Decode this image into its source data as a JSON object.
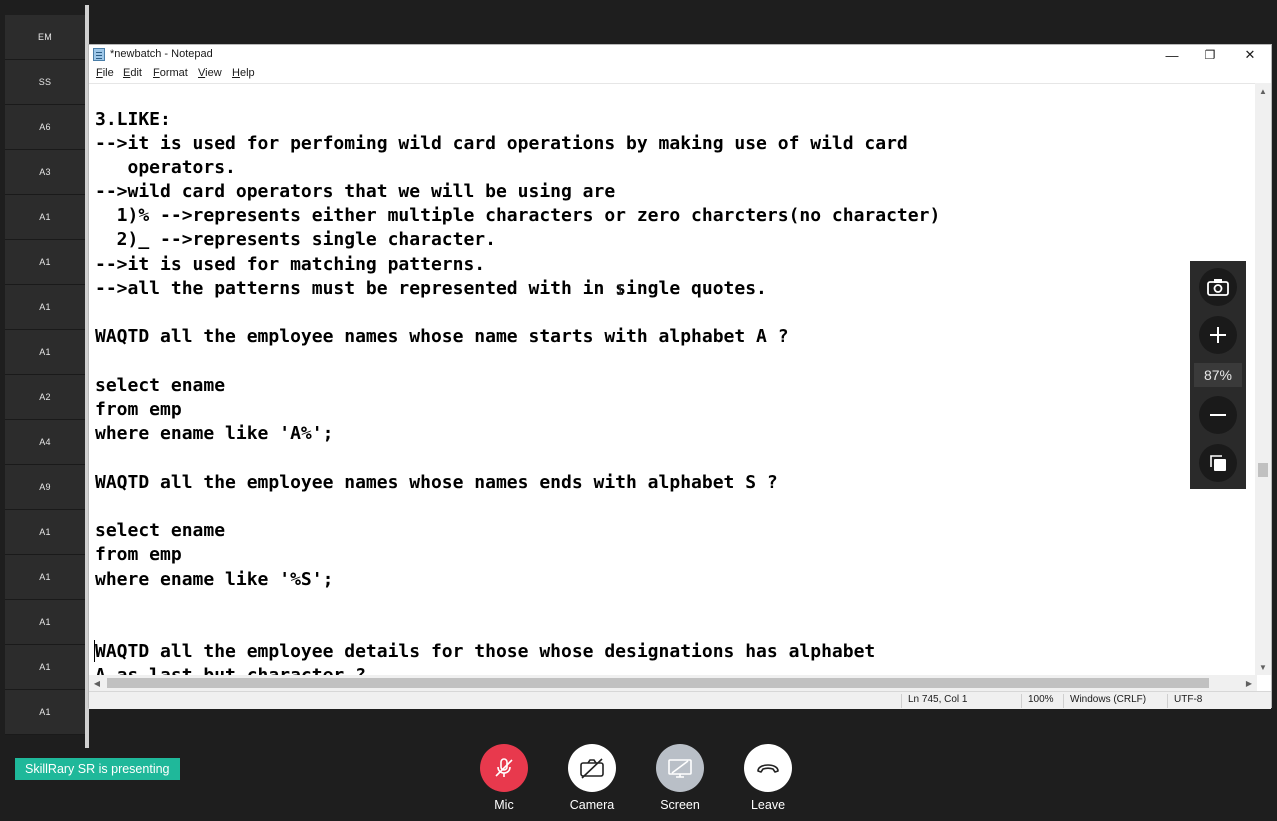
{
  "participants": [
    "EM",
    "SS",
    "A6",
    "A3",
    "A1",
    "A1",
    "A1",
    "A1",
    "A2",
    "A4",
    "A9",
    "A1",
    "A1",
    "A1",
    "A1",
    "A1"
  ],
  "notepad": {
    "title": "*newbatch - Notepad",
    "window_buttons": {
      "minimize": "—",
      "restore": "❐",
      "close": "✕"
    },
    "menu": [
      "File",
      "Edit",
      "Format",
      "View",
      "Help"
    ],
    "lines": [
      "3.LIKE:",
      "-->it is used for perfoming wild card operations by making use of wild card",
      "   operators.",
      "-->wild card operators that we will be using are",
      "  1)% -->represents either multiple characters or zero charcters(no character)",
      "  2)_ -->represents single character.",
      "-->it is used for matching patterns.",
      "-->all the patterns must be represented with in single quotes.",
      "",
      "WAQTD all the employee names whose name starts with alphabet A ?",
      "",
      "select ename",
      "from emp",
      "where ename like 'A%';",
      "",
      "WAQTD all the employee names whose names ends with alphabet S ?",
      "",
      "select ename",
      "from emp",
      "where ename like '%S';",
      "",
      "",
      "WAQTD all the employee details for those whose designations has alphabet",
      "A as last but character ?"
    ],
    "status": {
      "position": "Ln 745, Col 1",
      "zoom": "100%",
      "line_ending": "Windows (CRLF)",
      "encoding": "UTF-8"
    }
  },
  "zoom_panel": {
    "level": "87%"
  },
  "meeting": {
    "presenting": "SkillRary SR is presenting",
    "controls": [
      {
        "label": "Mic",
        "color": "#e8394d"
      },
      {
        "label": "Camera",
        "color": "#ffffff"
      },
      {
        "label": "Screen",
        "color": "#b9bfc7"
      },
      {
        "label": "Leave",
        "color": "#ffffff"
      }
    ]
  }
}
